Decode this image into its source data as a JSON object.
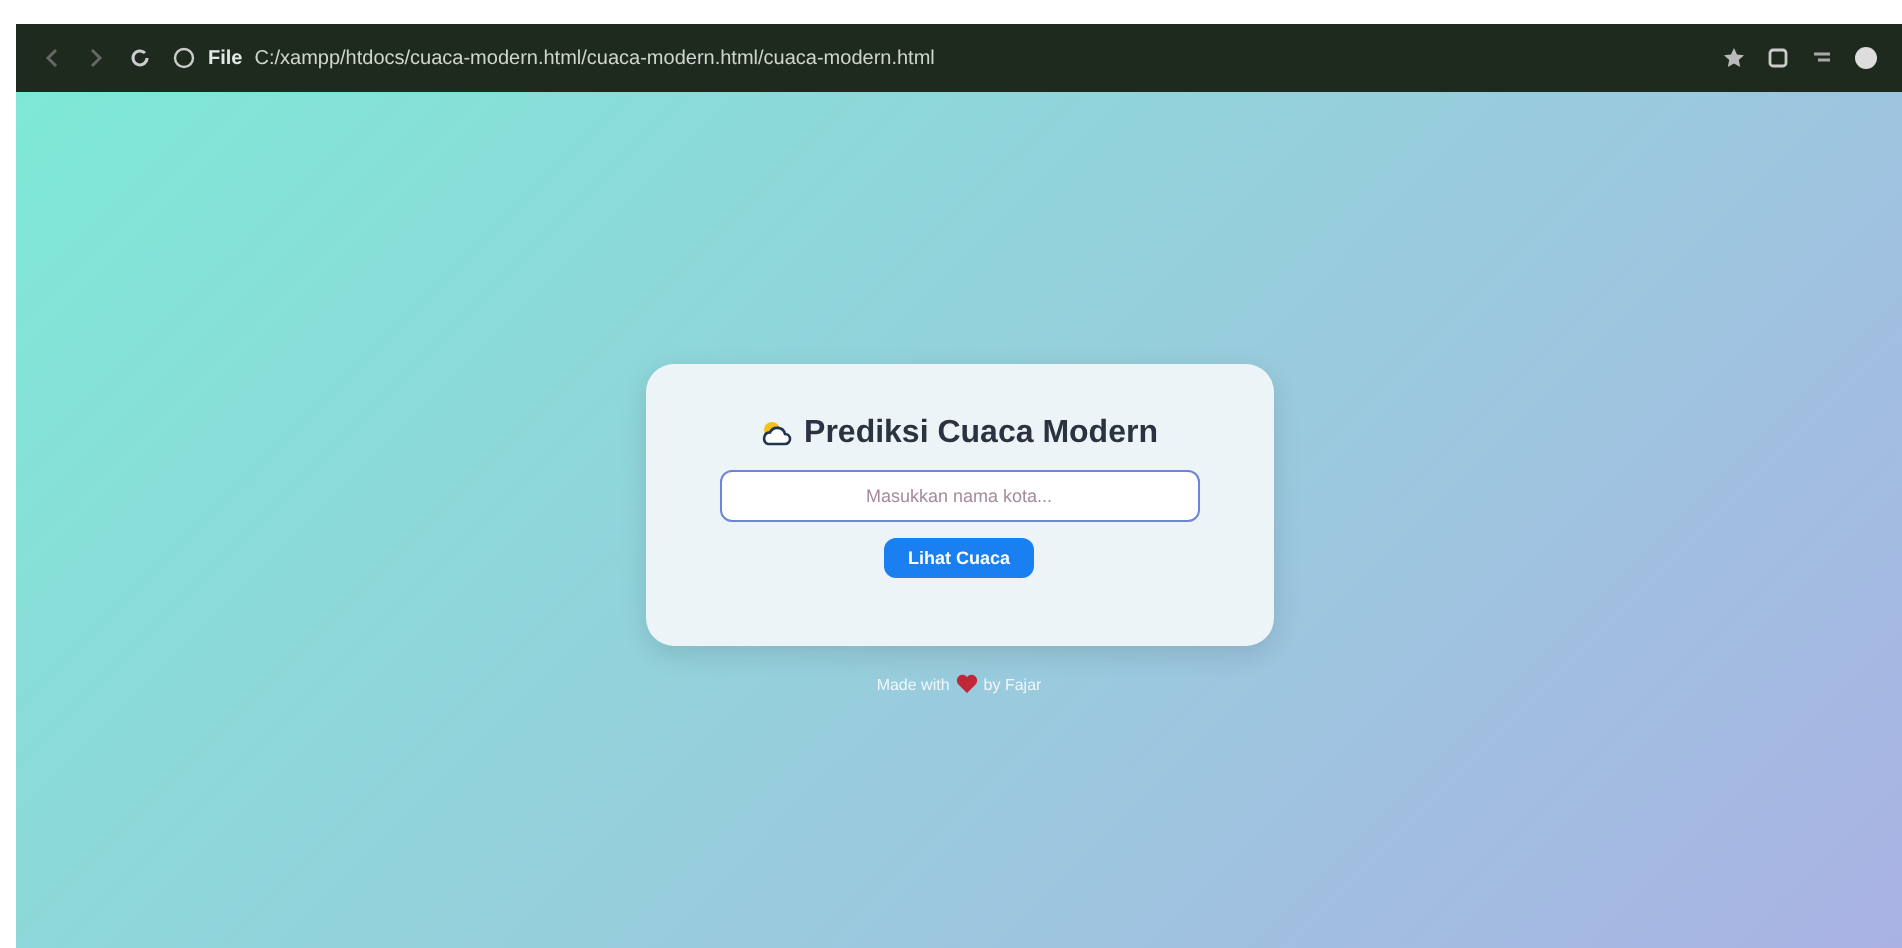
{
  "browser": {
    "address_prefix": "File",
    "url": "C:/xampp/htdocs/cuaca-modern.html/cuaca-modern.html/cuaca-modern.html"
  },
  "card": {
    "title": "Prediksi Cuaca Modern",
    "search": {
      "placeholder": "Masukkan nama kota..."
    },
    "button": "Lihat Cuaca"
  },
  "footer": {
    "before": "Made with",
    "after": "by Fajar"
  }
}
